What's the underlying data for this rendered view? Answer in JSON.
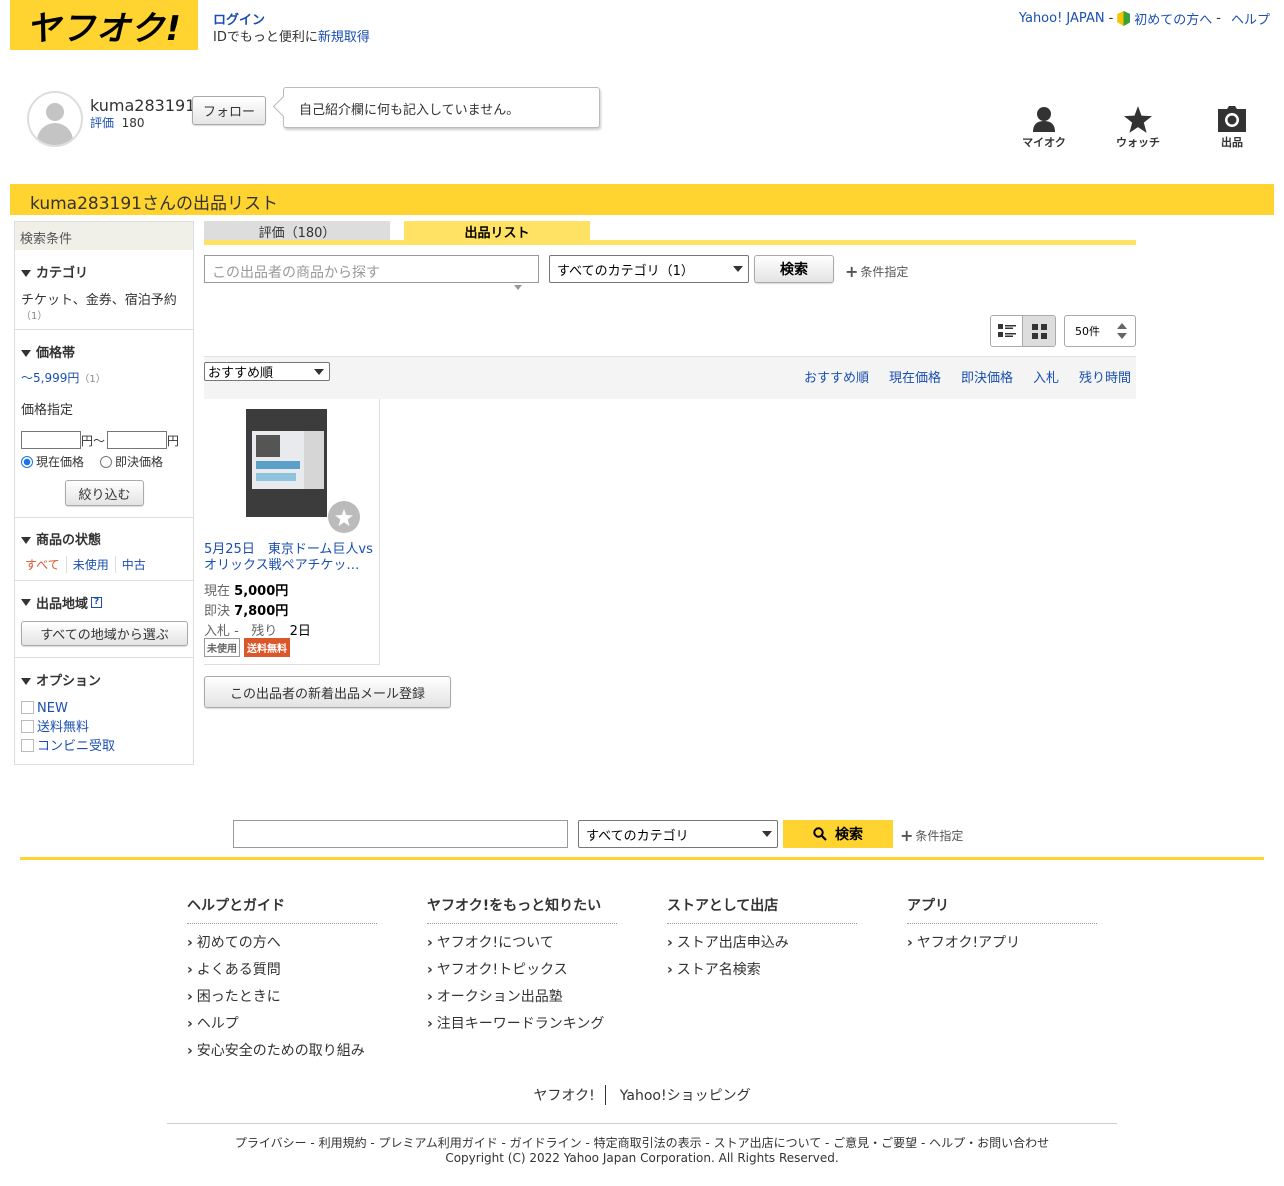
{
  "header": {
    "logo": "ヤフオク!",
    "login": "ログイン",
    "id_prefix": "IDでもっと便利に",
    "register": "新規取得",
    "yahoo_japan": "Yahoo! JAPAN",
    "beginners": "初めての方へ",
    "help": "ヘルプ",
    "sep": "-"
  },
  "profile": {
    "username": "kuma283191",
    "rating_label": "評価",
    "rating_value": "180",
    "follow": "フォロー",
    "bio": "自己紹介欄に何も記入していません。"
  },
  "nav_icons": [
    {
      "label": "マイオク",
      "icon": "user-icon"
    },
    {
      "label": "ウォッチ",
      "icon": "star-icon"
    },
    {
      "label": "出品",
      "icon": "camera-icon"
    }
  ],
  "band_title": "kuma283191さんの出品リスト",
  "sidebar": {
    "title": "検索条件",
    "category_head": "カテゴリ",
    "category_link": "チケット、金券、宿泊予約",
    "category_count": "（1）",
    "price_head": "価格帯",
    "price_link": "〜5,999円",
    "price_count": "（1）",
    "price_specify": "価格指定",
    "yen1": "円～",
    "yen2": "円",
    "radio_current": "現在価格",
    "radio_buynow": "即決価格",
    "narrow": "絞り込む",
    "condition_head": "商品の状態",
    "cond_all": "すべて",
    "cond_new": "未使用",
    "cond_used": "中古",
    "region_head": "出品地域",
    "region_btn": "すべての地域から選ぶ",
    "option_head": "オプション",
    "options": [
      "NEW",
      "送料無料",
      "コンビニ受取"
    ]
  },
  "tabs": {
    "rating": "評価（180）",
    "list": "出品リスト"
  },
  "search": {
    "placeholder": "この出品者の商品から探す",
    "category": "すべてのカテゴリ（1）",
    "button": "検索",
    "advanced": "条件指定"
  },
  "view": {
    "per_page": "50件"
  },
  "sort": {
    "selected": "おすすめ順",
    "links": [
      "おすすめ順",
      "現在価格",
      "即決価格",
      "入札",
      "残り時間"
    ]
  },
  "item": {
    "title_line1": "5月25日　東京ドーム巨人vs",
    "title_line2": "オリックス戦ペアチケッ…",
    "current_label": "現在",
    "current_price": "5,000円",
    "buynow_label": "即決",
    "buynow_price": "7,800円",
    "bids_label": "入札 -",
    "remain_label": "残り",
    "remain_value": "2日",
    "badge_used": "未使用",
    "badge_shipping": "送料無料"
  },
  "mail_register": "この出品者の新着出品メール登録",
  "footer_search": {
    "category": "すべてのカテゴリ",
    "button": "検索",
    "advanced": "条件指定"
  },
  "footer": {
    "columns": [
      {
        "head": "ヘルプとガイド",
        "items": [
          "初めての方へ",
          "よくある質問",
          "困ったときに",
          "ヘルプ",
          "安心安全のための取り組み"
        ]
      },
      {
        "head": "ヤフオク!をもっと知りたい",
        "items": [
          "ヤフオク!について",
          "ヤフオク!トピックス",
          "オークション出品塾",
          "注目キーワードランキング"
        ]
      },
      {
        "head": "ストアとして出店",
        "items": [
          "ストア出店申込み",
          "ストア名検索"
        ]
      },
      {
        "head": "アプリ",
        "items": [
          "ヤフオク!アプリ"
        ]
      }
    ],
    "brand1": "ヤフオク!",
    "brand2": "Yahoo!ショッピング",
    "links": "プライバシー - 利用規約 - プレミアム利用ガイド - ガイドライン - 特定商取引法の表示 - ストア出店について - ご意見・ご要望 - ヘルプ・お問い合わせ",
    "copyright": "Copyright (C) 2022 Yahoo Japan Corporation. All Rights Reserved."
  },
  "colors": {
    "brand_yellow": "#ffd330",
    "link_blue": "#1a4fb0",
    "accent_orange": "#d9572b"
  }
}
